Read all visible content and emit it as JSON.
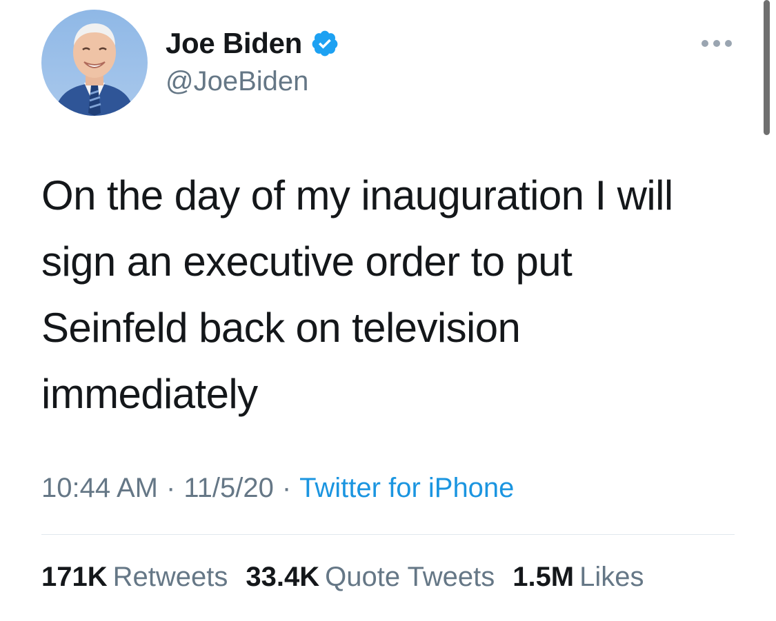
{
  "author": {
    "display_name": "Joe Biden",
    "handle": "@JoeBiden",
    "verified": true
  },
  "tweet": {
    "text_lines": [
      "On the day of my inauguration I will",
      "sign an executive order to put",
      "Seinfeld back on television",
      "immediately"
    ],
    "time": "10:44 AM",
    "date": "11/5/20",
    "separator": "·",
    "source": "Twitter for iPhone"
  },
  "stats": [
    {
      "count": "171K",
      "label": "Retweets"
    },
    {
      "count": "33.4K",
      "label": "Quote Tweets"
    },
    {
      "count": "1.5M",
      "label": "Likes"
    }
  ],
  "colors": {
    "text": "#14171a",
    "secondary": "#657786",
    "link": "#1b95e0",
    "verified": "#1da1f2",
    "divider": "#e1e8ed"
  },
  "icons": {
    "verified": "verified-badge-icon",
    "more": "more-options-icon"
  }
}
